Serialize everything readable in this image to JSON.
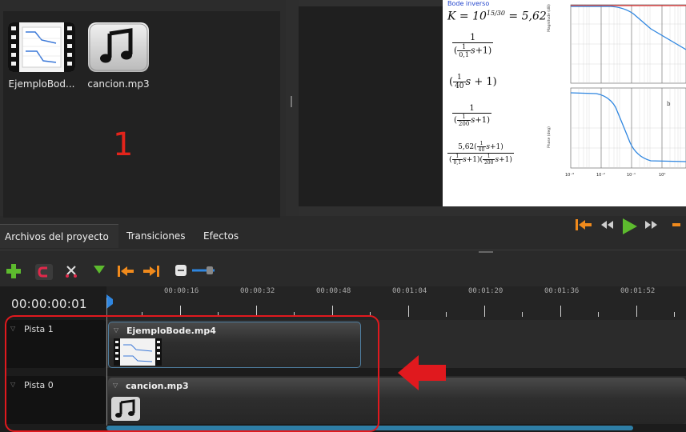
{
  "project_files": {
    "items": [
      {
        "label": "EjemploBod..."
      },
      {
        "label": "cancion.mp3"
      }
    ],
    "annotation": "1"
  },
  "preview": {
    "doc_heading": "Bode inverso",
    "equation_k": "K = 10^(15/30) = 5,62",
    "ylabel_magnitude": "Magnitude (dB)",
    "ylabel_phase": "Phase (deg)",
    "x_ticks": [
      "10⁻³",
      "10⁻²",
      "10⁻¹",
      "10⁰"
    ]
  },
  "tabs": [
    {
      "label": "Archivos del proyecto",
      "active": true
    },
    {
      "label": "Transiciones",
      "active": false
    },
    {
      "label": "Efectos",
      "active": false
    }
  ],
  "timeline": {
    "current_time": "00:00:00:01",
    "ruler_labels": [
      "00:00:16",
      "00:00:32",
      "00:00:48",
      "00:01:04",
      "00:01:20",
      "00:01:36",
      "00:01:52"
    ],
    "tracks": [
      {
        "name": "Pista 1",
        "clip": "EjemploBode.mp4"
      },
      {
        "name": "Pista 0",
        "clip": "cancion.mp3"
      }
    ]
  },
  "colors": {
    "annotation_red": "#e3241b",
    "accent_orange": "#f08a1c",
    "play_green": "#5dbb2e",
    "scroll_blue": "#2e7ea6"
  }
}
